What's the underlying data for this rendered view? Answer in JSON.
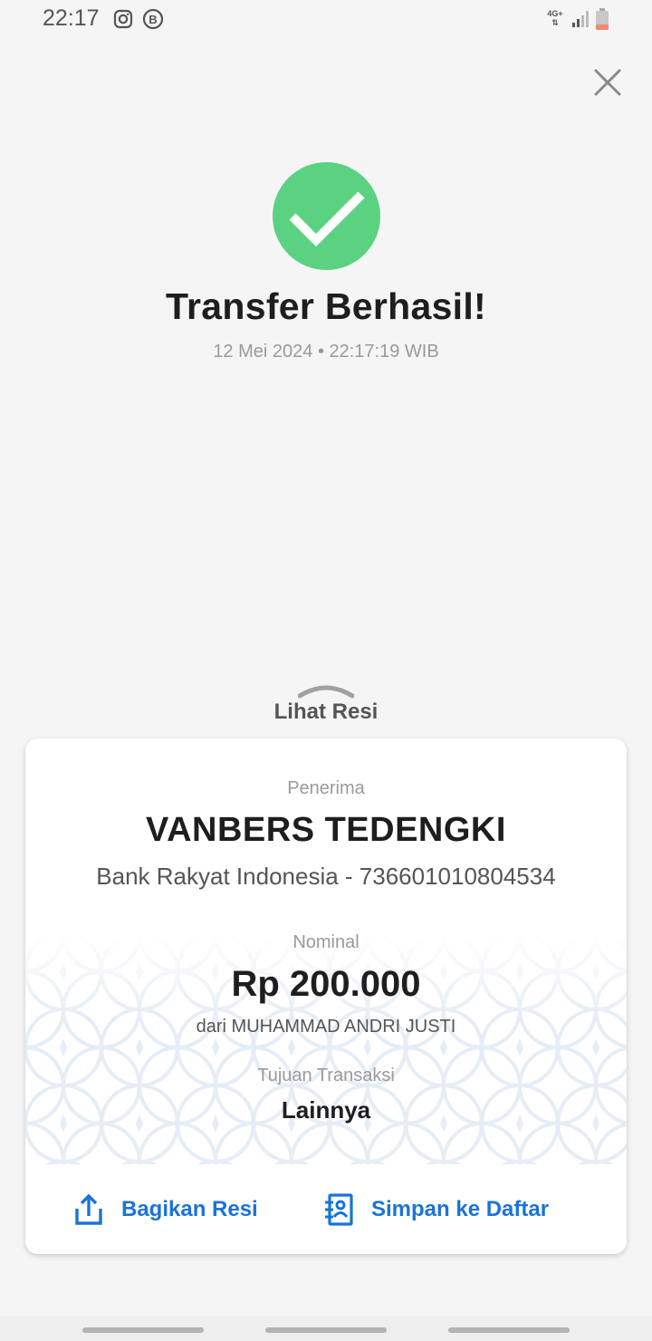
{
  "status_bar": {
    "time": "22:17",
    "network": "4G+",
    "icons": [
      "instagram-icon",
      "b-app-icon",
      "signal-icon",
      "battery-icon"
    ]
  },
  "header": {
    "close_icon": "close-icon",
    "success_icon": "check-circle-icon",
    "title": "Transfer Berhasil!",
    "datetime": "12 Mei 2024 • 22:17:19 WIB"
  },
  "receipt_toggle": {
    "label": "Lihat Resi",
    "icon": "chevron-up-icon"
  },
  "receipt": {
    "recipient_label": "Penerima",
    "recipient_name": "VANBERS TEDENGKI",
    "recipient_bank": "Bank Rakyat Indonesia - 736601010804534",
    "amount_label": "Nominal",
    "amount": "Rp 200.000",
    "sender": "dari MUHAMMAD ANDRI JUSTI",
    "purpose_label": "Tujuan Transaksi",
    "purpose": "Lainnya"
  },
  "actions": {
    "share_label": "Bagikan Resi",
    "share_icon": "share-icon",
    "save_label": "Simpan ke Daftar",
    "save_icon": "contact-add-icon"
  },
  "colors": {
    "background": "#f5f5f5",
    "success": "#5bd281",
    "accent": "#1a73d9",
    "text_primary": "#1e1e1e",
    "text_secondary": "#9a9a9a"
  }
}
